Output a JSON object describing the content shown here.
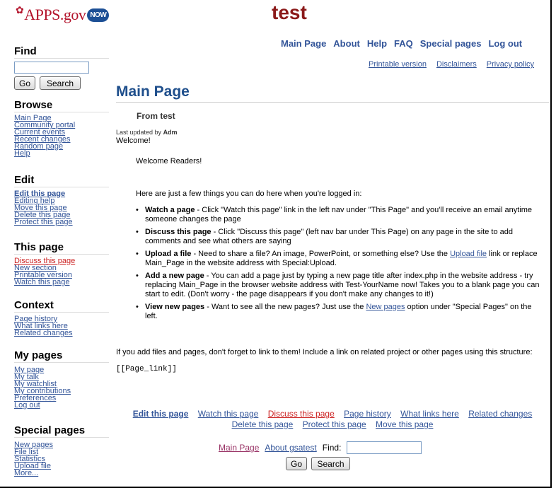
{
  "logo": {
    "text": "APPS.gov",
    "badge": "NOW"
  },
  "site_title": "test",
  "top_nav": [
    "Main Page",
    "About",
    "Help",
    "FAQ",
    "Special pages",
    "Log out"
  ],
  "top_links": [
    "Printable version",
    "Disclaimers",
    "Privacy policy"
  ],
  "sidebar": {
    "find_heading": "Find",
    "go_label": "Go",
    "search_label": "Search",
    "browse": {
      "heading": "Browse",
      "items": [
        "Main Page",
        "Community portal",
        "Current events",
        "Recent changes",
        "Random page",
        "Help"
      ]
    },
    "edit": {
      "heading": "Edit",
      "items": [
        "Edit this page",
        "Editing help",
        "Move this page",
        "Delete this page",
        "Protect this page"
      ]
    },
    "this_page": {
      "heading": "This page",
      "items": [
        "Discuss this page",
        "New section",
        "Printable version",
        "Watch this page"
      ]
    },
    "context": {
      "heading": "Context",
      "items": [
        "Page history",
        "What links here",
        "Related changes"
      ]
    },
    "my_pages": {
      "heading": "My pages",
      "items": [
        "My page",
        "My talk",
        "My watchlist",
        "My contributions",
        "Preferences",
        "Log out"
      ]
    },
    "special": {
      "heading": "Special pages",
      "items": [
        "New pages",
        "File list",
        "Statistics",
        "Upload file",
        "More..."
      ]
    }
  },
  "main": {
    "title": "Main Page",
    "from": "From test",
    "updated_prefix": "Last updated by ",
    "updated_user": "Adm",
    "welcome": "Welcome!",
    "readers": "Welcome Readers!",
    "intro": "Here are just a few things you can do here when you're logged in:",
    "bullets": [
      {
        "bold": "Watch a page",
        "text": " - Click \"Watch this page\" link in the left nav under \"This Page\" and you'll receive an email anytime someone changes the page"
      },
      {
        "bold": "Discuss this page",
        "text": " - Click \"Discuss this page\" (left nav bar under This Page) on any page in the site to add comments and see what others are saying"
      },
      {
        "bold": "Upload a file",
        "text": " - Need to share a file? An image, PowerPoint, or something else? Use the ",
        "link": "Upload file",
        "text2": " link or replace Main_Page in the website address with Special:Upload."
      },
      {
        "bold": "Add a new page",
        "text": " - You can add a page just by typing a new page title after index.php in the website address - try replacing Main_Page in the browser website address with Test-YourName now! Takes you to a blank page you can start to edit. (Don't worry - the page disappears if you don't make any changes to it!)"
      },
      {
        "bold": "View new pages",
        "text": " - Want to see all the new pages? Just use the ",
        "link": "New pages",
        "text2": " option under \"Special Pages\" on the left."
      }
    ],
    "linkline": "If you add files and pages, don't forget to link to them! Include a link on related project or other pages using this structure:",
    "code": "[[Page_link]]"
  },
  "bottom_links": {
    "row1": [
      "Edit this page",
      "Watch this page",
      "Discuss this page",
      "Page history",
      "What links here",
      "Related changes"
    ],
    "row2": [
      "Delete this page",
      "Protect this page",
      "Move this page"
    ]
  },
  "footer": {
    "main_page": "Main Page",
    "about": "About gsatest",
    "find_label": "Find:",
    "go": "Go",
    "search": "Search"
  },
  "colors": {
    "link": "#335599",
    "title": "#8b1a1a",
    "heading": "#1f4f8c",
    "red_link": "#cc2222"
  }
}
